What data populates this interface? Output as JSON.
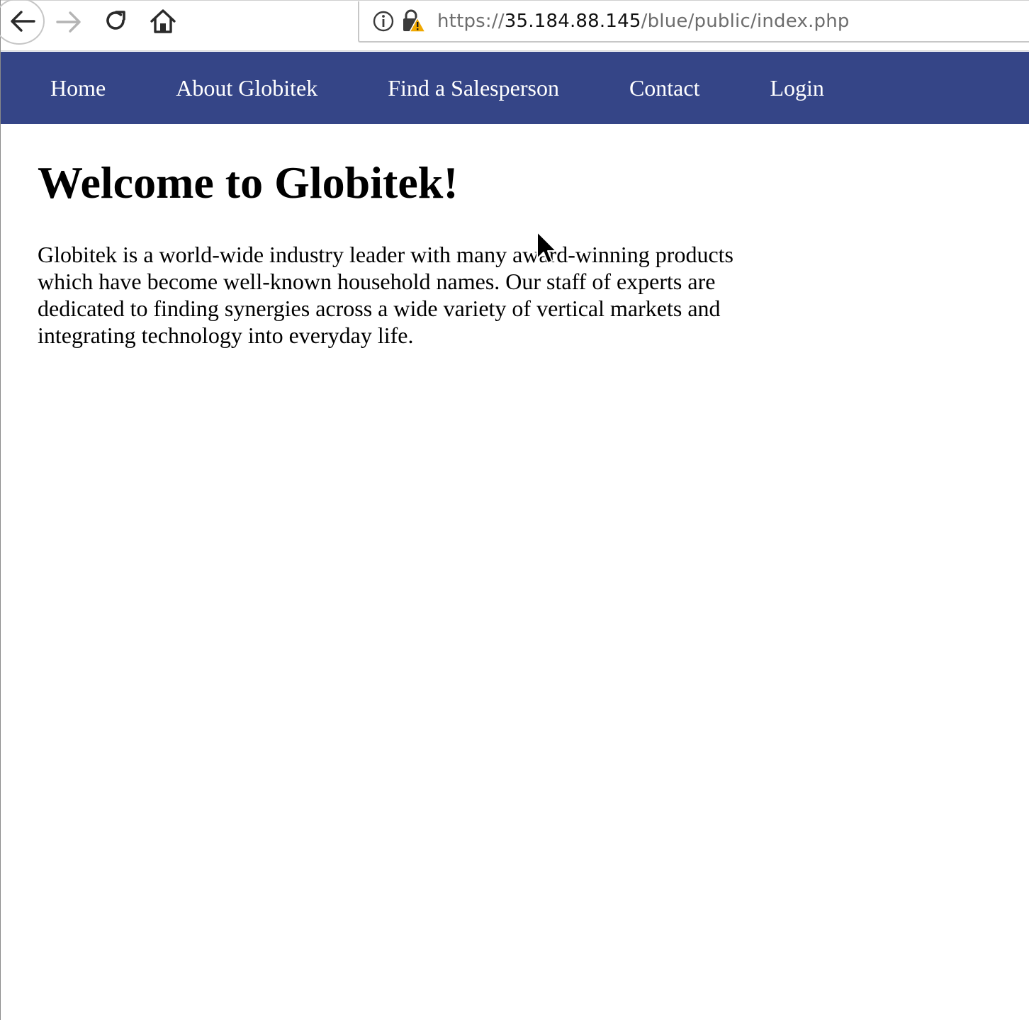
{
  "browser": {
    "back_icon": "arrow-left-icon",
    "forward_icon": "arrow-right-icon",
    "reload_icon": "reload-icon",
    "home_icon": "home-icon",
    "info_icon": "info-icon",
    "lock_icon": "lock-warning-icon",
    "url": {
      "scheme": "https://",
      "host": "35.184.88.145",
      "path": "/blue/public/index.php"
    }
  },
  "nav": {
    "background": "#354587",
    "items": [
      {
        "label": "Home"
      },
      {
        "label": "About Globitek"
      },
      {
        "label": "Find a Salesperson"
      },
      {
        "label": "Contact"
      },
      {
        "label": "Login"
      }
    ]
  },
  "main": {
    "heading": "Welcome to Globitek!",
    "intro": "Globitek is a world-wide industry leader with many award-winning products which have become well-known household names. Our staff of experts are dedicated to finding synergies across a wide variety of vertical markets and integrating technology into everyday life."
  }
}
